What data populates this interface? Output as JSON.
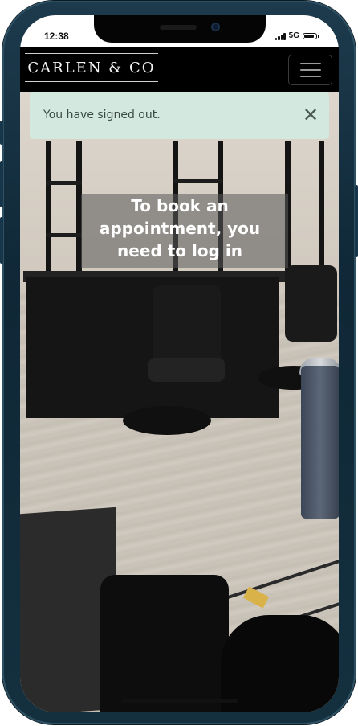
{
  "status_bar": {
    "time": "12:38",
    "network": "5G",
    "icons": [
      "signal-icon",
      "battery-icon"
    ]
  },
  "nav": {
    "logo": "CARLEN & CO",
    "menu_icon": "hamburger-menu-icon"
  },
  "alert": {
    "message": "You have signed out.",
    "close_icon": "close-icon",
    "close_glyph": "✕"
  },
  "hero": {
    "heading": "To book an appointment, you need to log in",
    "background": "barbershop-interior-photo"
  },
  "colors": {
    "nav_background": "#000000",
    "alert_background": "#d3e8df",
    "alert_text": "#3a4a42",
    "heading_text": "#ffffff"
  }
}
